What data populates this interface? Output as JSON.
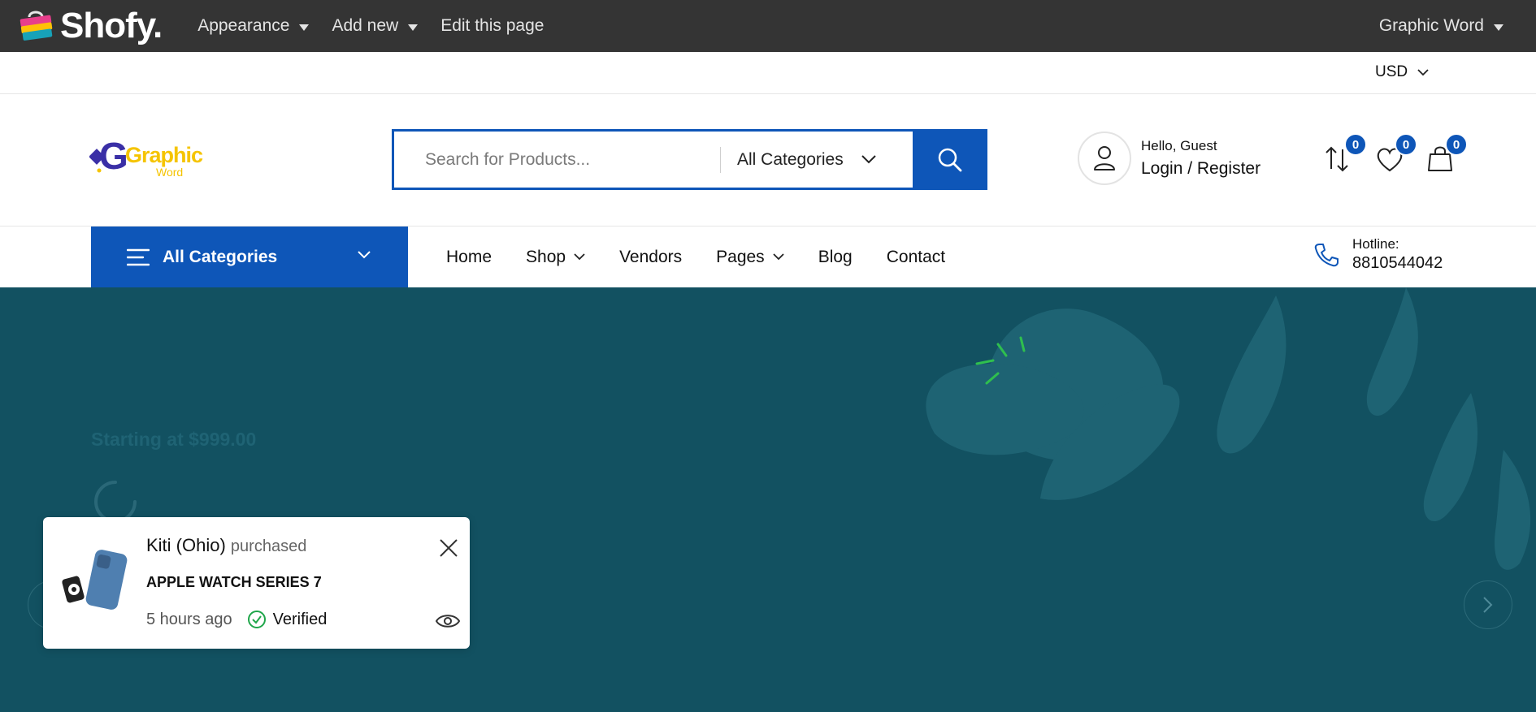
{
  "admin_bar": {
    "brand": "Shofy.",
    "menu": [
      {
        "label": "Appearance",
        "dropdown": true
      },
      {
        "label": "Add new",
        "dropdown": true
      },
      {
        "label": "Edit this page",
        "dropdown": false
      }
    ],
    "user": "Graphic Word"
  },
  "top_strip": {
    "currency": "USD"
  },
  "header": {
    "logo_text": "Graphic",
    "logo_subtext": "Word",
    "search_placeholder": "Search for Products...",
    "search_category": "All Categories",
    "greeting": "Hello, Guest",
    "login_label": "Login / Register",
    "compare_count": "0",
    "wishlist_count": "0",
    "cart_count": "0"
  },
  "navbar": {
    "all_categories": "All Categories",
    "links": [
      {
        "label": "Home",
        "dropdown": false
      },
      {
        "label": "Shop",
        "dropdown": true
      },
      {
        "label": "Vendors",
        "dropdown": false
      },
      {
        "label": "Pages",
        "dropdown": true
      },
      {
        "label": "Blog",
        "dropdown": false
      },
      {
        "label": "Contact",
        "dropdown": false
      }
    ],
    "hotline_label": "Hotline:",
    "hotline_number": "8810544042"
  },
  "hero": {
    "price_text": "Starting at $999.00"
  },
  "popup": {
    "buyer": "Kiti (Ohio)",
    "action": "purchased",
    "product": "APPLE WATCH SERIES 7",
    "time": "5 hours ago",
    "verified": "Verified"
  },
  "colors": {
    "primary": "#0e56b8",
    "admin_bar": "#343434",
    "hero_bg": "#125161",
    "verified_green": "#1fa64a"
  }
}
